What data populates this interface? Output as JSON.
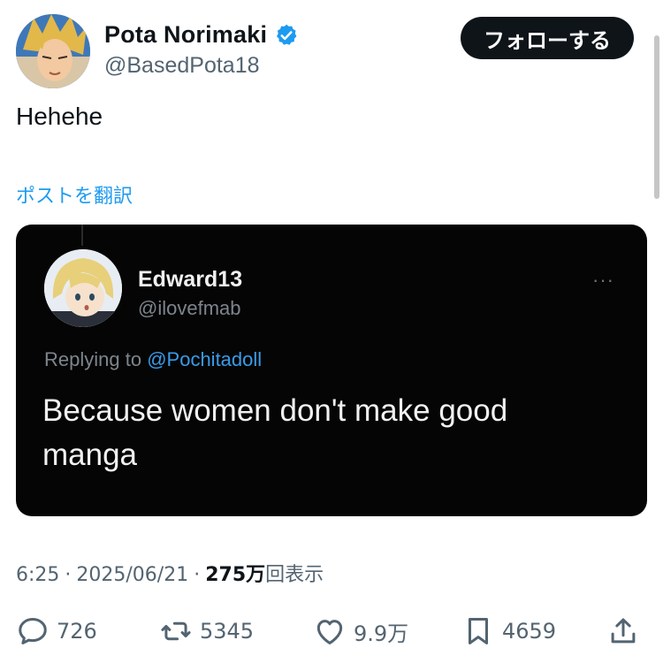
{
  "author": {
    "display_name": "Pota Norimaki",
    "handle": "@BasedPota18",
    "verified": true
  },
  "follow_button": {
    "label": "フォローする"
  },
  "post": {
    "text": "Hehehe",
    "translate_label": "ポストを翻訳"
  },
  "quoted_screenshot": {
    "name": "Edward13",
    "handle": "@ilovefmab",
    "more": "···",
    "replying_prefix": "Replying to",
    "replying_to": "@Pochitadoll",
    "body": "Because women don't make good manga"
  },
  "meta": {
    "time": "6:25",
    "separator": "·",
    "date": "2025/06/21",
    "views_number": "275",
    "views_unit": "万",
    "views_label": "回表示"
  },
  "actions": {
    "replies": "726",
    "reposts": "5345",
    "likes": "9.9万",
    "bookmarks": "4659"
  },
  "colors": {
    "accent": "#1d9bf0",
    "text_primary": "#0f1419",
    "text_secondary": "#536471",
    "media_background": "#050505"
  },
  "icons": {
    "verified": "verified-badge-icon",
    "reply": "reply-bubble-icon",
    "repost": "repost-arrows-icon",
    "like": "heart-icon",
    "bookmark": "bookmark-icon",
    "share": "share-upload-icon"
  }
}
